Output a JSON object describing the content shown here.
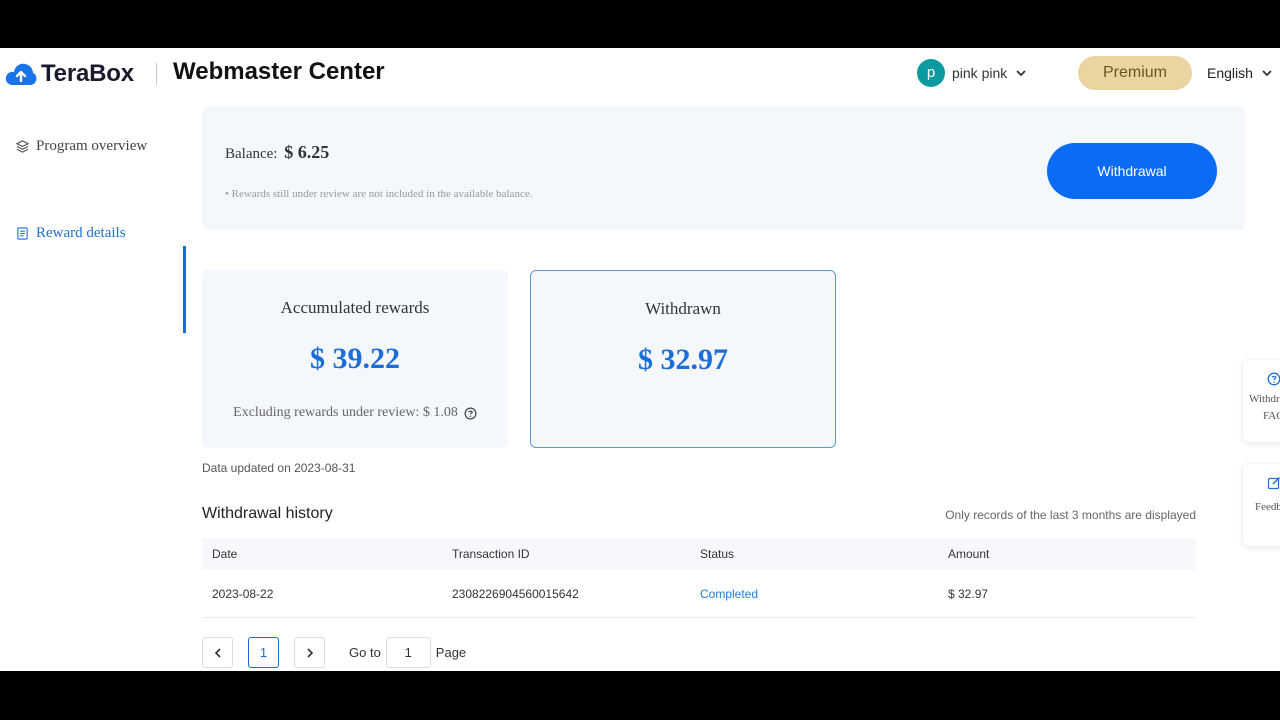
{
  "header": {
    "logo_text": "TeraBox",
    "title": "Webmaster Center",
    "user": {
      "avatar_letter": "p",
      "name": "pink pink"
    },
    "premium_label": "Premium",
    "language": "English"
  },
  "sidebar": {
    "items": [
      {
        "label": "Program overview",
        "icon": "layers-icon",
        "active": false
      },
      {
        "label": "Reward details",
        "icon": "document-icon",
        "active": true
      }
    ]
  },
  "balance": {
    "label": "Balance:",
    "value": "$ 6.25",
    "note": "• Rewards still under review are not included in the available balance.",
    "withdraw_label": "Withdrawal"
  },
  "stats": {
    "accumulated": {
      "title": "Accumulated rewards",
      "value": "$ 39.22",
      "sub": "Excluding rewards under review: $ 1.08"
    },
    "withdrawn": {
      "title": "Withdrawn",
      "value": "$ 32.97"
    }
  },
  "data_updated": "Data updated on 2023-08-31",
  "history": {
    "title": "Withdrawal history",
    "note": "Only records of the last 3 months are displayed",
    "columns": [
      "Date",
      "Transaction ID",
      "Status",
      "Amount"
    ],
    "rows": [
      {
        "date": "2023-08-22",
        "transaction_id": "2308226904560015642",
        "status": "Completed",
        "amount": "$ 32.97"
      }
    ]
  },
  "pagination": {
    "current_page": "1",
    "goto_label": "Go to",
    "goto_value": "1",
    "page_label": "Page"
  },
  "float_widgets": {
    "faq_lines": [
      "Withdr",
      "FAQ"
    ],
    "feedback_lines": [
      "Feedb"
    ]
  },
  "colors": {
    "accent": "#0a6cf5",
    "link": "#1e6fd0",
    "premium_bg": "#ead4a2",
    "avatar_bg": "#0b9aa0"
  }
}
